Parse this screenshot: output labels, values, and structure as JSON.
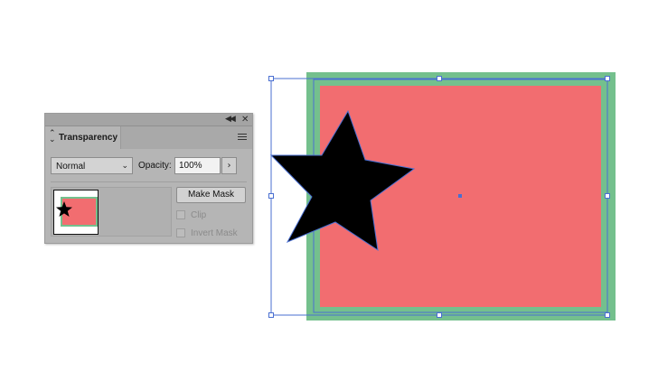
{
  "panel": {
    "title": "Transparency",
    "blend_mode": "Normal",
    "opacity_label": "Opacity:",
    "opacity_value": "100%",
    "make_mask_label": "Make Mask",
    "clip_label": "Clip",
    "invert_mask_label": "Invert Mask",
    "clip_checked": false,
    "invert_mask_checked": false,
    "options_enabled": false
  },
  "icons": {
    "collapse": "double-chevron-left-icon",
    "close": "close-icon",
    "tab_toggle": "up-down-arrows-icon",
    "menu": "hamburger-menu-icon",
    "blend_dropdown": "chevron-down-icon",
    "opacity_popup": "chevron-right-icon"
  },
  "colors": {
    "rect_fill": "#f26d70",
    "rect_stroke": "#74c08d",
    "star_fill": "#000000",
    "selection": "#4a6fd1",
    "panel_bg": "#b5b5b5"
  }
}
